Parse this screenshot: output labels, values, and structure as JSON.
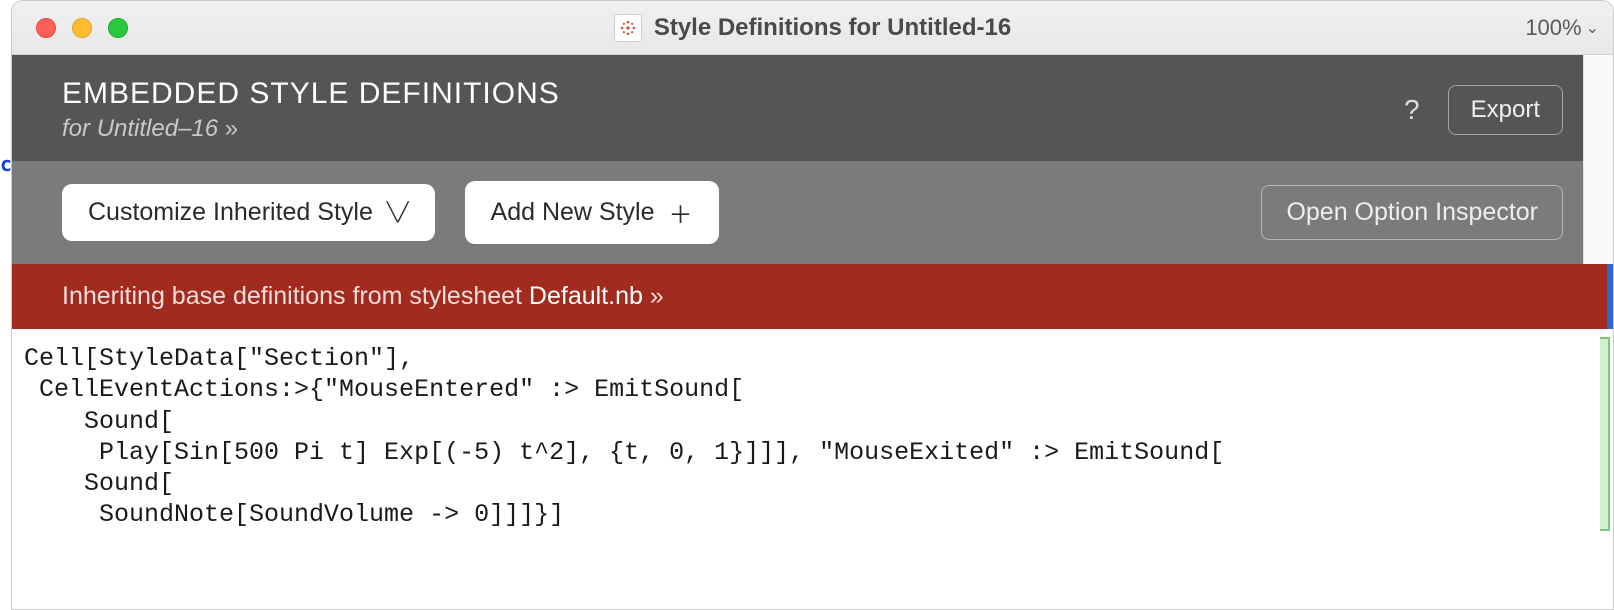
{
  "window": {
    "title": "Style Definitions for Untitled-16",
    "zoom": "100%"
  },
  "header": {
    "title": "EMBEDDED STYLE DEFINITIONS",
    "subtitle_prefix": "for ",
    "subtitle_name": "Untitled–16",
    "help": "?",
    "export": "Export"
  },
  "toolbar": {
    "customize": "Customize Inherited Style",
    "add": "Add New Style",
    "inspector": "Open Option Inspector"
  },
  "banner": {
    "prefix": "Inheriting base definitions from stylesheet ",
    "stylesheet": "Default.nb"
  },
  "code": "Cell[StyleData[\"Section\"],\n CellEventActions:>{\"MouseEntered\" :> EmitSound[\n    Sound[\n     Play[Sin[500 Pi t] Exp[(-5) t^2], {t, 0, 1}]]], \"MouseExited\" :> EmitSound[\n    Sound[\n     SoundNote[SoundVolume -> 0]]]}]"
}
